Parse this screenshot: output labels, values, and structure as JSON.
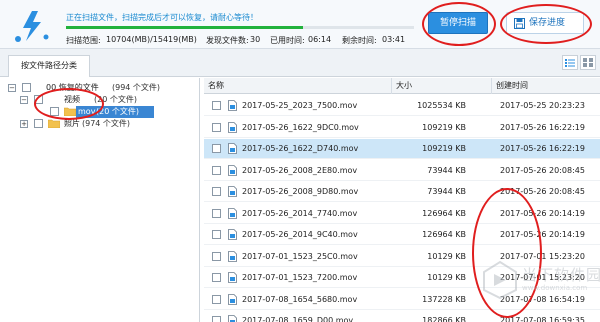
{
  "header": {
    "scan_message": "正在扫描文件，扫描完成后才可以恢复，请耐心等待！",
    "progress_percent": 68,
    "stats": {
      "range_label": "扫描范围:",
      "range_value": "10704(MB)/15419(MB)",
      "found_label": "发现文件数:",
      "found_value": "30",
      "elapsed_label": "已用时间:",
      "elapsed_value": "06:14",
      "remaining_label": "剩余时间:",
      "remaining_value": "03:41"
    },
    "pause_button": "暂停扫描",
    "save_button": "保存进度"
  },
  "tabs": {
    "path_tab": "按文件路径分类"
  },
  "tree": {
    "root": {
      "label": "00 恢复的文件",
      "count": "(994 个文件)"
    },
    "video": {
      "label": "视频",
      "count": "(20 个文件)"
    },
    "mov": {
      "label": "mov",
      "count": "(20 个文件)"
    },
    "photo": {
      "label": "照片",
      "count": "(974 个文件)"
    }
  },
  "table": {
    "columns": {
      "name": "名称",
      "size": "大小",
      "created": "创建时间"
    },
    "rows": [
      {
        "name": "2017-05-25_2023_7500.mov",
        "size": "1025534 KB",
        "created": "2017-05-25 20:23:23"
      },
      {
        "name": "2017-05-26_1622_9DC0.mov",
        "size": "109219 KB",
        "created": "2017-05-26 16:22:19"
      },
      {
        "name": "2017-05-26_1622_D740.mov",
        "size": "109219 KB",
        "created": "2017-05-26 16:22:19"
      },
      {
        "name": "2017-05-26_2008_2E80.mov",
        "size": "73944 KB",
        "created": "2017-05-26 20:08:45"
      },
      {
        "name": "2017-05-26_2008_9D80.mov",
        "size": "73944 KB",
        "created": "2017-05-26 20:08:45"
      },
      {
        "name": "2017-05-26_2014_7740.mov",
        "size": "126964 KB",
        "created": "2017-05-26 20:14:19"
      },
      {
        "name": "2017-05-26_2014_9C40.mov",
        "size": "126964 KB",
        "created": "2017-05-26 20:14:19"
      },
      {
        "name": "2017-07-01_1523_25C0.mov",
        "size": "10129 KB",
        "created": "2017-07-01 15:23:20"
      },
      {
        "name": "2017-07-01_1523_7200.mov",
        "size": "10129 KB",
        "created": "2017-07-01 15:23:20"
      },
      {
        "name": "2017-07-08_1654_5680.mov",
        "size": "137228 KB",
        "created": "2017-07-08 16:54:19"
      },
      {
        "name": "2017-07-08_1659_D00.mov",
        "size": "182866 KB",
        "created": "2017-07-08 16:59:35"
      }
    ]
  },
  "watermark": {
    "text": "当下软件园",
    "url": "www.downxia.com"
  },
  "colors": {
    "accent": "#2b8fe0",
    "progress": "#22b23c",
    "annotation": "#e01e1e",
    "selected_row": "#cde6f8"
  }
}
